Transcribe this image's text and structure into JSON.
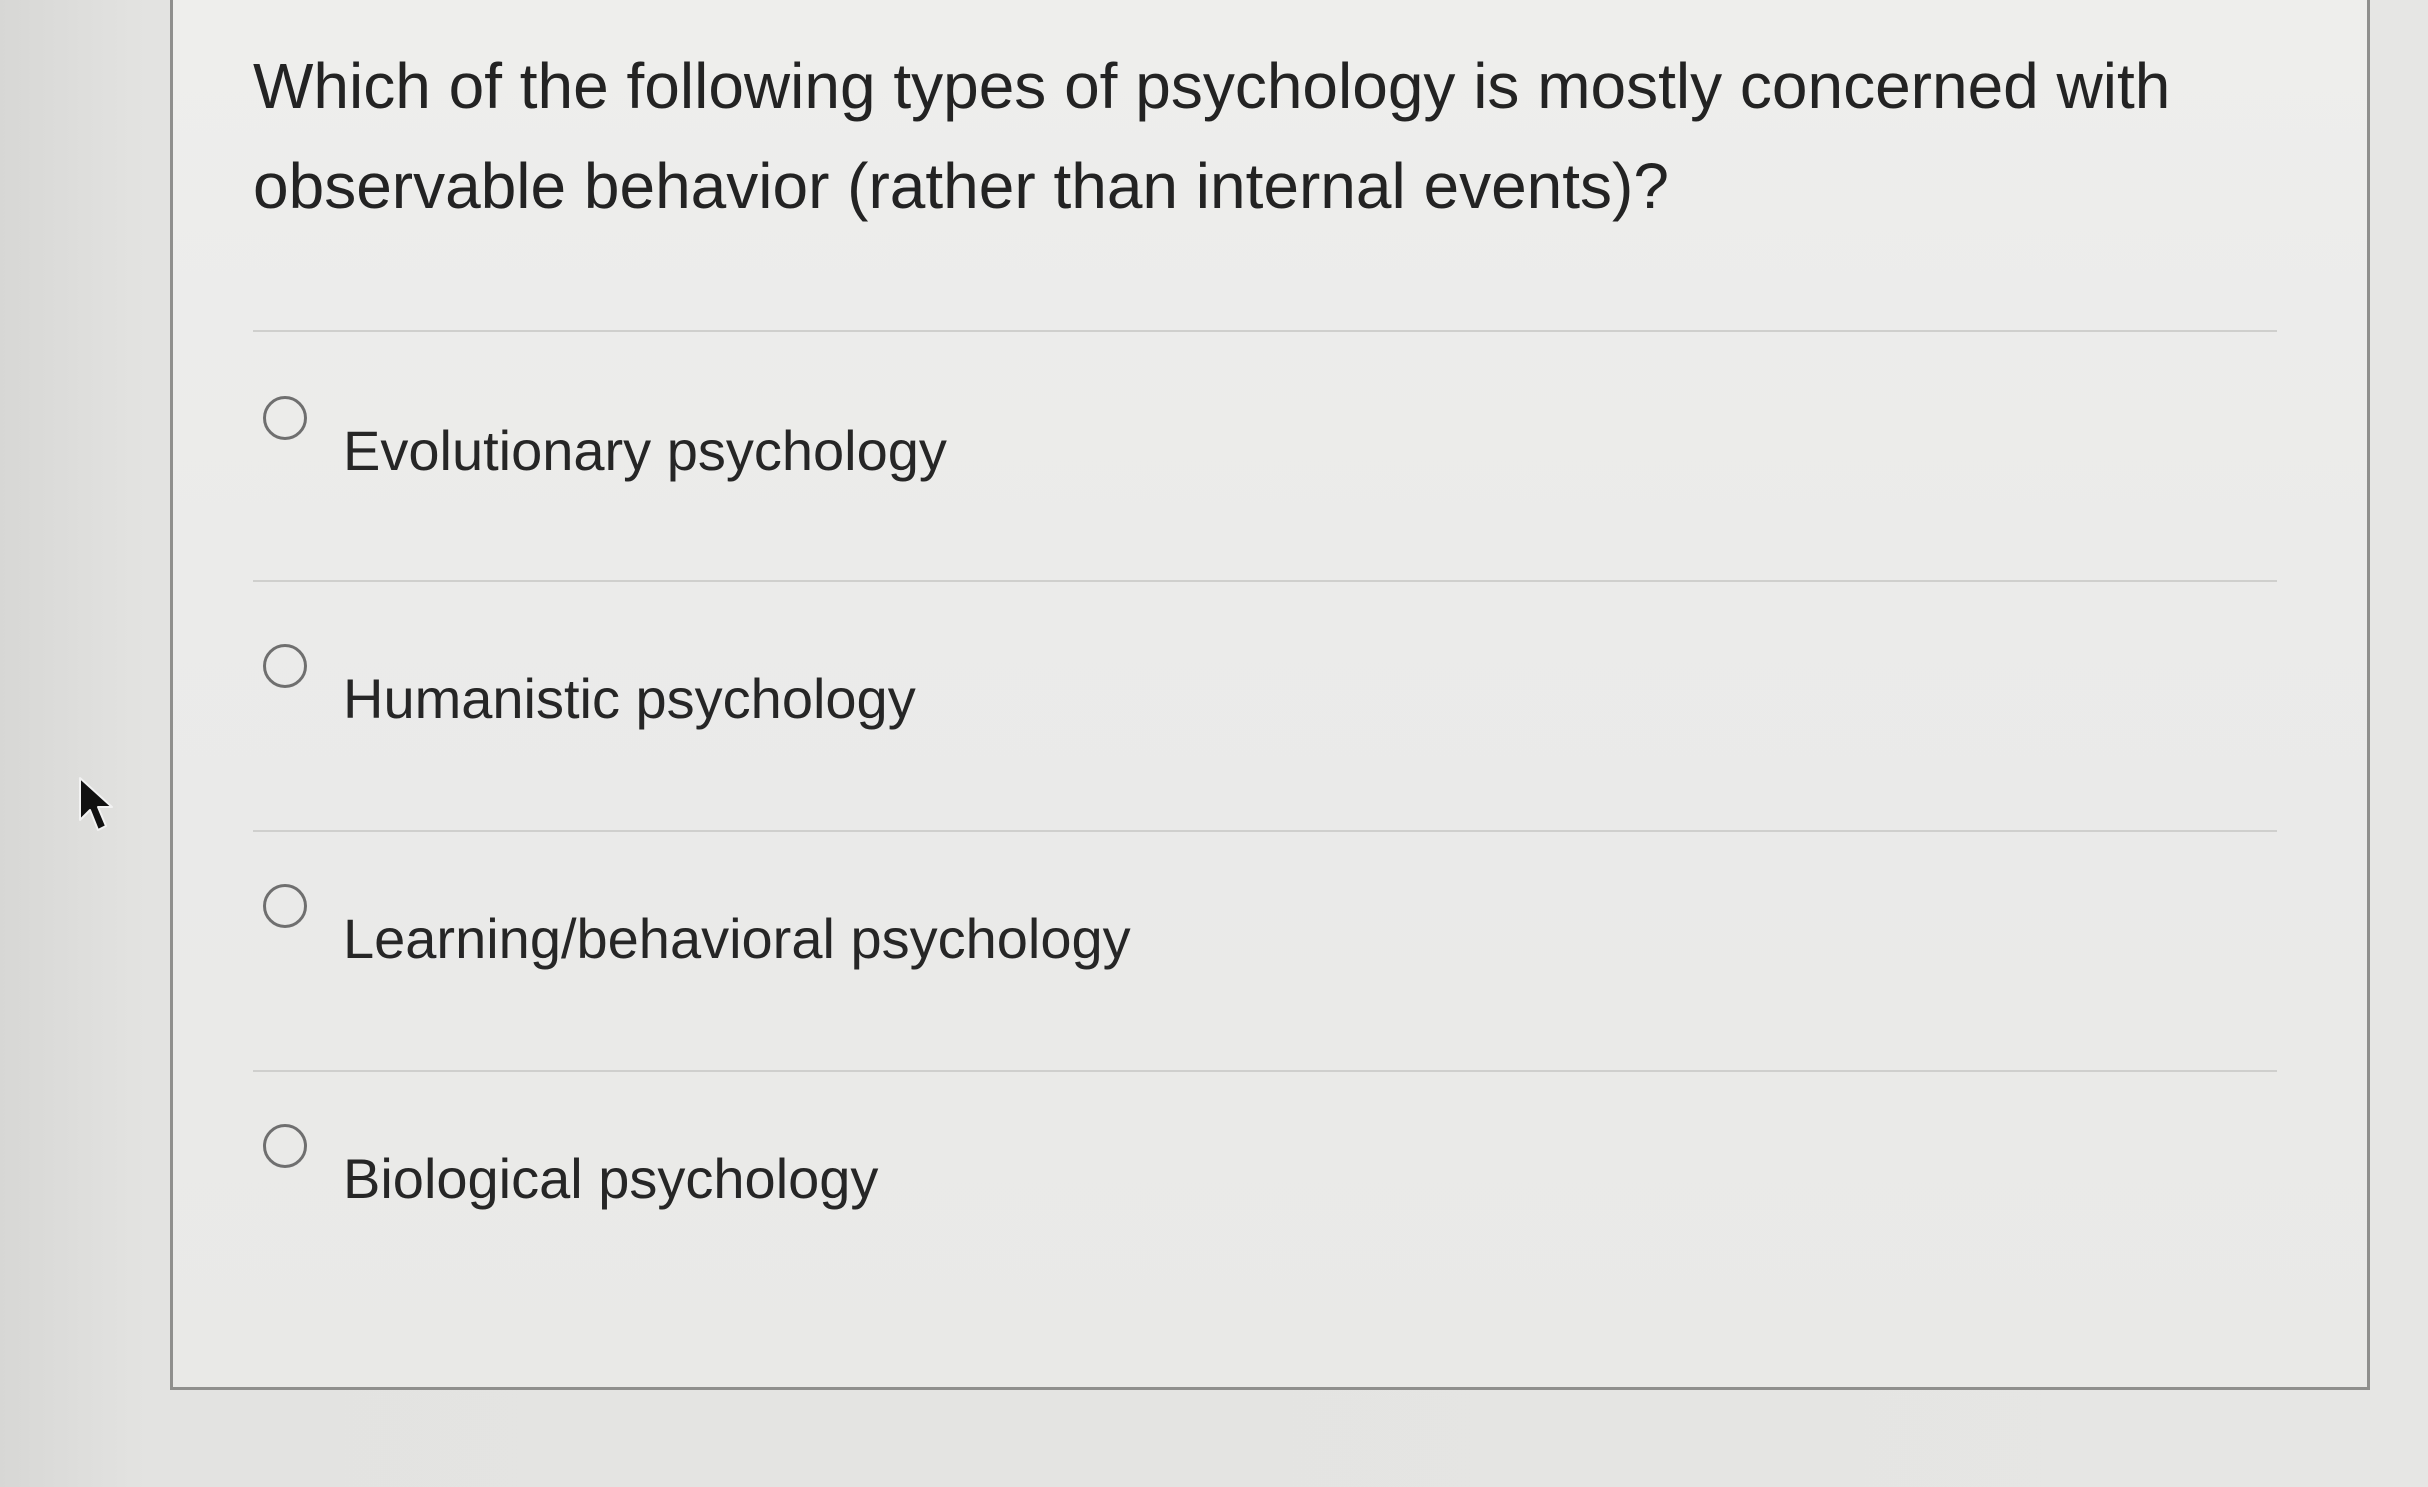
{
  "question": {
    "text": "Which of the following types of psychology is mostly concerned with observable behavior (rather than internal events)?"
  },
  "options": [
    {
      "label": "Evolutionary psychology",
      "selected": false
    },
    {
      "label": "Humanistic psychology",
      "selected": false
    },
    {
      "label": "Learning/behavioral psychology",
      "selected": false
    },
    {
      "label": "Biological psychology",
      "selected": false
    }
  ],
  "colors": {
    "background": "#e3e3e1",
    "card": "#ecece9",
    "text": "#262626",
    "radio_border": "#6f6f6f"
  }
}
